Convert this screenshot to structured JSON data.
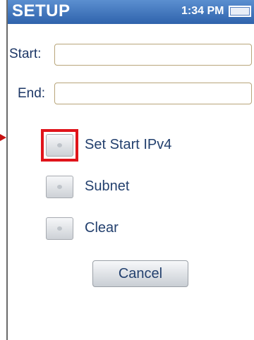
{
  "header": {
    "title": "SETUP",
    "time": "1:34 PM",
    "battery_icon": "battery-icon"
  },
  "form": {
    "start_label": "Start:",
    "start_value": "",
    "end_label": "End:",
    "end_value": ""
  },
  "options": [
    {
      "label": "Set Start IPv4",
      "selected": true
    },
    {
      "label": "Subnet",
      "selected": false
    },
    {
      "label": "Clear",
      "selected": false
    }
  ],
  "actions": {
    "cancel_label": "Cancel"
  },
  "colors": {
    "title_bar": "#2f63ac",
    "highlight": "#e0141b",
    "label_text": "#23406e"
  }
}
